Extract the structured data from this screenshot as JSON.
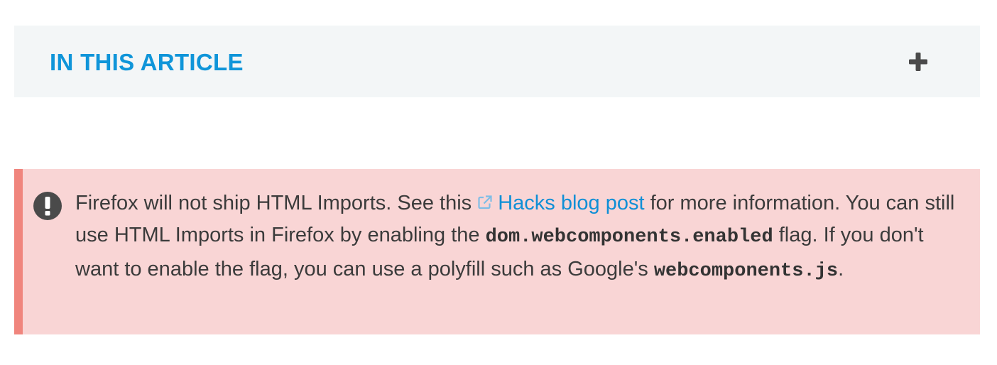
{
  "toc": {
    "title": "IN THIS ARTICLE",
    "toggle_icon": "plus-icon"
  },
  "notice": {
    "type": "warning",
    "icon": "exclamation-circle-icon",
    "text_part1": "Firefox will not ship HTML Imports. See this ",
    "link_icon": "external-link-icon",
    "link_text": "Hacks blog post",
    "text_part2": " for more information. You can still use HTML Imports in Firefox by enabling the ",
    "code_flag": "dom.webcomponents.enabled",
    "text_part3": " flag. If you don't want to enable the flag, you can use a polyfill such as Google's ",
    "code_polyfill": "webcomponents.js",
    "text_part4": "."
  },
  "colors": {
    "toc_background": "#f3f6f7",
    "toc_title": "#0f95d9",
    "notice_background": "#f9d5d5",
    "notice_border": "#f0857d",
    "link": "#0f8fd6",
    "body_text": "#3b3b3b"
  }
}
